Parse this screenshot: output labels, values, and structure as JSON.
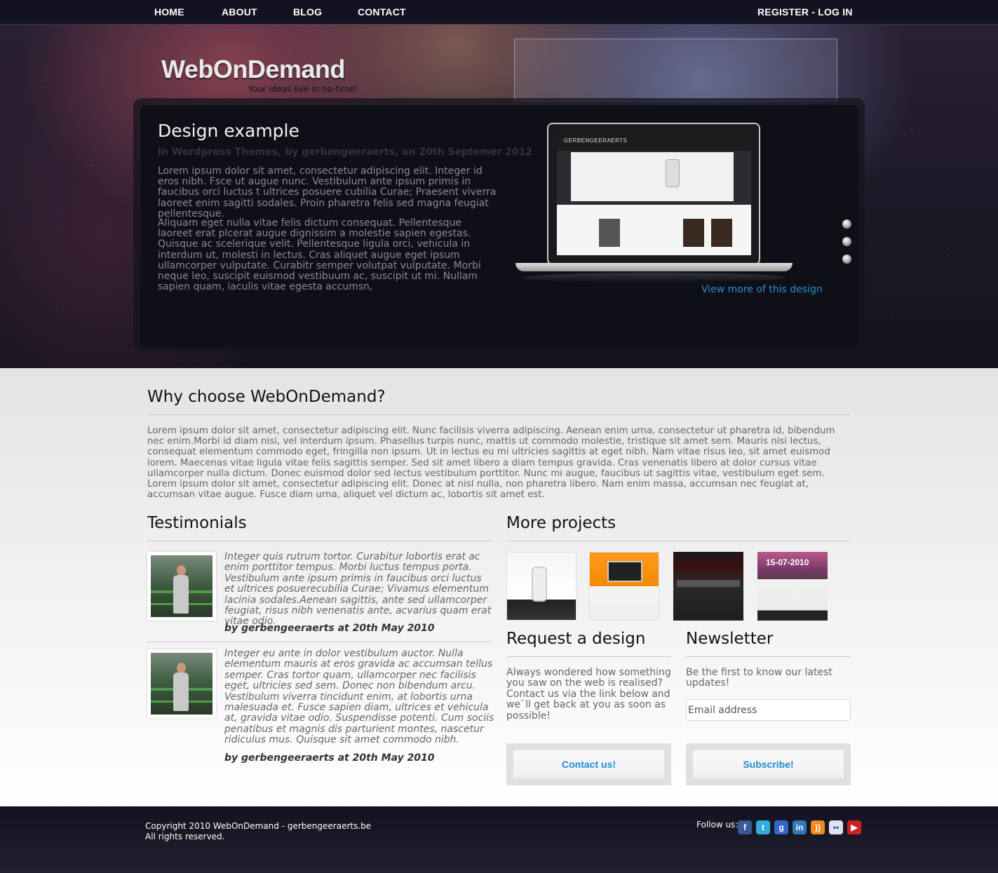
{
  "nav": {
    "home": "HOME",
    "about": "ABOUT",
    "blog": "BLOG",
    "contact": "CONTACT",
    "auth": "REGISTER - LOG IN"
  },
  "header": {
    "logo": "WebOnDemand",
    "tagline": "Your ideas live in no-time!"
  },
  "feature": {
    "title": "Design example",
    "meta": "In Wordpress Themes, by gerbengeeraerts, on 20th Septemer 2012",
    "paragraph1": "Lorem ipsum dolor sit amet, consectetur adipiscing elit. Integer id eros nibh. Fsce ut augue nunc. Vestibulum ante ipsum primis in faucibus orci luctus t ultrices posuere cubilia Curae; Praesent viverra laoreet enim sagitti sodales. Proin pharetra felis sed magna feugiat pellentesque.",
    "paragraph2": "Aliquam eget nulla vitae felis dictum consequat. Pellentesque laoreet erat plcerat augue dignissim a molestie sapien egestas. Quisque ac scelerique velit. Pellentesque ligula orci, vehicula in interdum ut, molesti in lectus. Cras aliquet augue eget ipsum ullamcorper vulputate. Curabitr semper volutpat vulputate. Morbi neque leo, suscipit euismod vestibuum ac, suscipit ut mi. Nullam sapien quam, iaculis vitae egesta accumsn,",
    "screen_logo": "GERBENGEERAERTS",
    "view_more": "View more of this design"
  },
  "why": {
    "title": "Why choose WebOnDemand?",
    "text": "Lorem ipsum dolor sit amet, consectetur adipiscing elit. Nunc facilisis viverra adipiscing. Aenean enim urna, consectetur ut pharetra id, bibendum nec enim.Morbi id diam nisi, vel interdum ipsum. Phasellus turpis nunc, mattis ut commodo molestie, tristique sit amet sem. Mauris nisi lectus, consequat elementum commodo eget, fringilla non ipsum. Ut in lectus eu mi ultricies sagittis at eget nibh. Nam vitae risus leo, sit amet euismod lorem. Maecenas vitae ligula vitae felis sagittis semper. Sed sit amet libero a diam tempus gravida. Cras venenatis libero at dolor cursus vitae ullamcorper nulla dictum. Donec euismod dolor sed lectus vestibulum porttitor. Nunc mi augue, faucibus ut sagittis vitae, vestibulum eget sem. Lorem ipsum dolor sit amet, consectetur adipiscing elit. Donec at nisl nulla, non pharetra libero. Nam enim massa, accumsan nec feugiat at, accumsan vitae augue. Fusce diam urna, aliquet vel dictum ac, lobortis sit amet est."
  },
  "testimonials": {
    "title": "Testimonials",
    "items": [
      {
        "quote": "Integer quis rutrum tortor. Curabitur lobortis erat ac enim porttitor tempus. Morbi luctus tempus porta. Vestibulum ante ipsum primis in faucibus orci luctus et ultrices posuerecubilia Curae; Vivamus elementum lacinia sodales.Aenean sagittis, ante sed ullamcorper feugiat, risus nibh venenatis ante, acvarius quam erat vitae odio.",
        "by": "by gerbengeeraerts at 20th May 2010"
      },
      {
        "quote": "Integer eu ante in dolor vestibulum auctor. Nulla elementum mauris at eros gravida ac accumsan tellus semper. Cras tortor quam, ullamcorper nec facilisis eget, ultricies sed sem. Donec non bibendum arcu. Vestibulum viverra tincidunt enim, at lobortis urna malesuada et. Fusce sapien diam, ultrices et vehicula at, gravida vitae odio. Suspendisse potenti. Cum sociis penatibus et magnis dis parturient montes, nascetur ridiculus mus. Quisque sit amet commodo nibh.",
        "by": "by gerbengeeraerts at 20th May 2010"
      }
    ]
  },
  "projects": {
    "title": "More projects",
    "thumb4_date": "15-07-2010"
  },
  "request": {
    "title": "Request a design",
    "text": "Always wondered how something you saw on the web is realised? Contact us via the link below and we`ll get back at you as soon as possible!",
    "button": "Contact us!"
  },
  "newsletter": {
    "title": "Newsletter",
    "text": "Be the first to know our latest updates!",
    "placeholder": "Email address",
    "button": "Subscribe!"
  },
  "footer": {
    "copyright": "Copyright 2010 WebOnDemand - gerbengeeraerts.be",
    "rights": "All rights reserved.",
    "follow": "Follow us:",
    "social": [
      {
        "icon": "facebook-icon",
        "glyph": "f",
        "color": "#3b5998"
      },
      {
        "icon": "twitter-icon",
        "glyph": "t",
        "color": "#33aadd"
      },
      {
        "icon": "google-icon",
        "glyph": "g",
        "color": "#3366cc"
      },
      {
        "icon": "linkedin-icon",
        "glyph": "in",
        "color": "#2f7bb8"
      },
      {
        "icon": "rss-icon",
        "glyph": "))",
        "color": "#f08a1c"
      },
      {
        "icon": "flickr-icon",
        "glyph": "••",
        "color": "#e0e0f0"
      },
      {
        "icon": "youtube-icon",
        "glyph": "▶",
        "color": "#cc2222"
      }
    ]
  }
}
